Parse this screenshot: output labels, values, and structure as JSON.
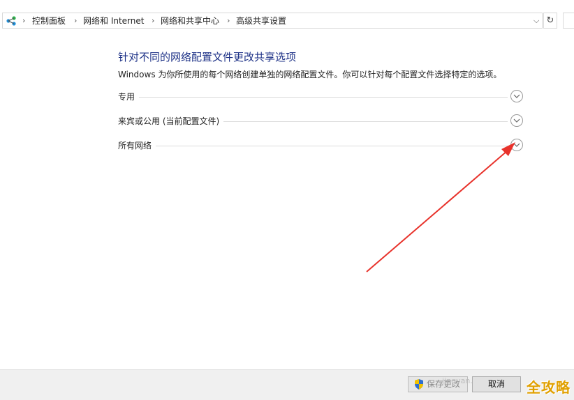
{
  "breadcrumb": {
    "items": [
      "控制面板",
      "网络和 Internet",
      "网络和共享中心",
      "高级共享设置"
    ]
  },
  "main": {
    "title": "针对不同的网络配置文件更改共享选项",
    "description": "Windows 为你所使用的每个网络创建单独的网络配置文件。你可以针对每个配置文件选择特定的选项。",
    "sections": [
      {
        "label": "专用"
      },
      {
        "label": "来宾或公用 (当前配置文件)"
      },
      {
        "label": "所有网络"
      }
    ]
  },
  "footer": {
    "save_label": "保存更改",
    "cancel_label": "取消"
  },
  "watermark": "jingyan.baidu.c",
  "logo_text": "全攻略",
  "colors": {
    "title": "#1e3287",
    "arrow": "#e8322b",
    "logo": "#e0a000"
  },
  "icons": {
    "network": "network-icon",
    "refresh": "refresh-icon",
    "expand": "chevron-down-icon",
    "shield": "uac-shield-icon"
  }
}
